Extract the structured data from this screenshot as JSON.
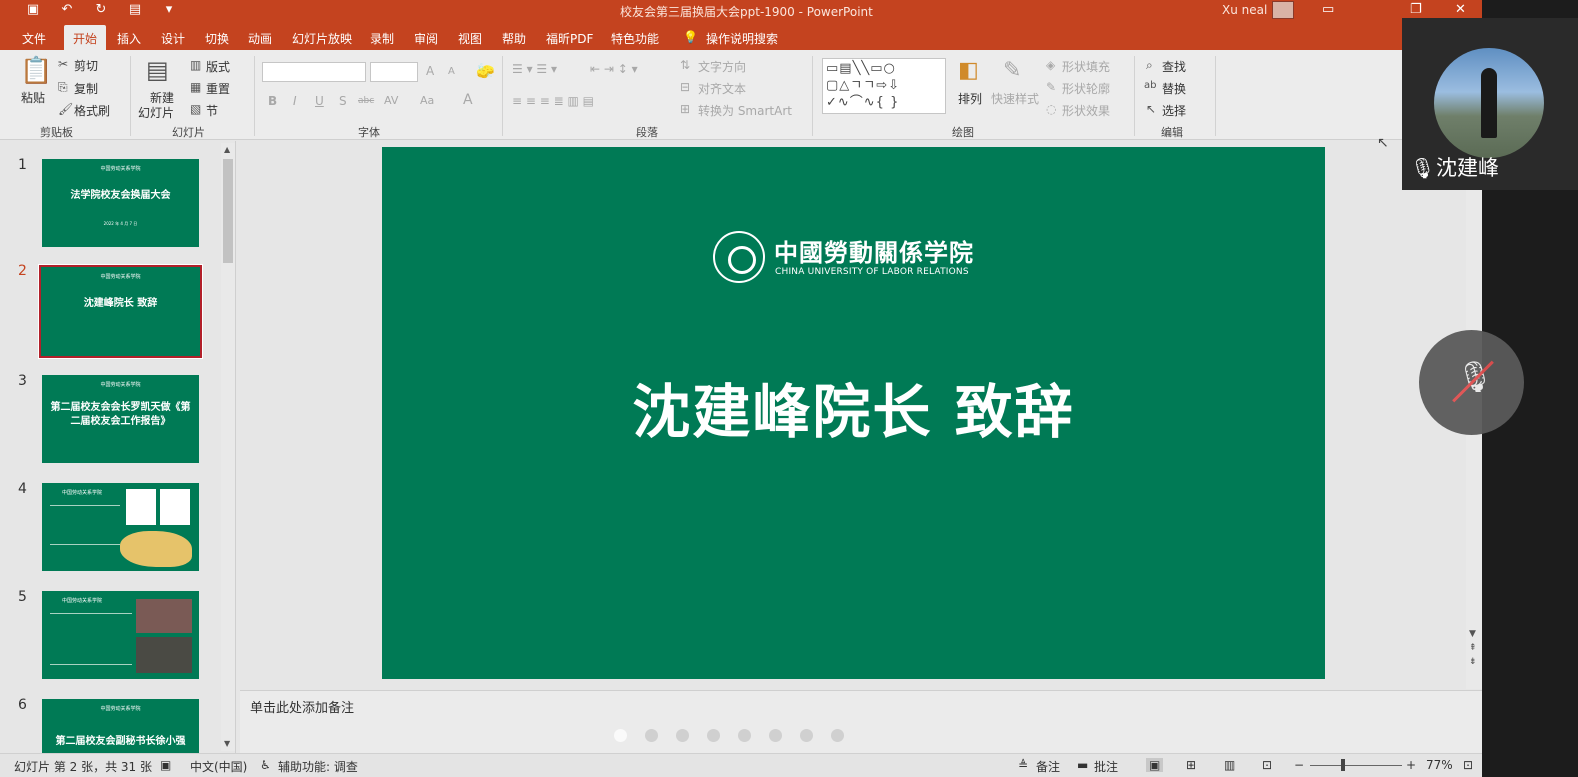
{
  "titlebar": {
    "doc_title": "校友会第三届换届大会ppt-1900  -  PowerPoint",
    "user": "Xu neal",
    "icons": [
      "save-icon",
      "undo-icon",
      "redo-icon",
      "present-icon",
      "customize-icon"
    ]
  },
  "menu": {
    "tabs": [
      "文件",
      "开始",
      "插入",
      "设计",
      "切换",
      "动画",
      "幻灯片放映",
      "录制",
      "审阅",
      "视图",
      "帮助",
      "福昕PDF",
      "特色功能"
    ],
    "active": "开始",
    "tell_me": "操作说明搜索"
  },
  "ribbon": {
    "clipboard": {
      "paste": "粘贴",
      "cut": "剪切",
      "copy": "复制",
      "format_painter": "格式刷",
      "label": "剪贴板"
    },
    "slides": {
      "new_slide_line1": "新建",
      "new_slide_line2": "幻灯片",
      "layout": "版式",
      "reset": "重置",
      "section": "节",
      "label": "幻灯片"
    },
    "font": {
      "label": "字体",
      "bold": "B",
      "italic": "I",
      "underline": "U",
      "shadow": "S",
      "strike": "abc",
      "spacing": "AV",
      "case": "Aa",
      "color": "A",
      "grow": "A",
      "shrink": "A"
    },
    "paragraph": {
      "label": "段落",
      "text_direction": "文字方向",
      "align_text": "对齐文本",
      "smartart": "转换为 SmartArt"
    },
    "drawing": {
      "label": "绘图",
      "arrange": "排列",
      "quick_styles": "快速样式",
      "shape_fill": "形状填充",
      "shape_outline": "形状轮廓",
      "shape_effects": "形状效果"
    },
    "editing": {
      "label": "编辑",
      "find": "查找",
      "replace": "替换",
      "select": "选择"
    }
  },
  "thumbnails": [
    {
      "num": "1",
      "title": "法学院校友会换届大会",
      "subtitle": "2022 年 4 月 7 日",
      "logo": "中国劳动关系学院"
    },
    {
      "num": "2",
      "title": "沈建峰院长  致辞",
      "logo": "中国劳动关系学院",
      "selected": true
    },
    {
      "num": "3",
      "title": "第二届校友会会长罗凯天做《第二届校友会工作报告》",
      "logo": "中国劳动关系学院"
    },
    {
      "num": "4",
      "title": "",
      "logo": "中国劳动关系学院"
    },
    {
      "num": "5",
      "title": "",
      "logo": "中国劳动关系学院"
    },
    {
      "num": "6",
      "title": "第二届校友会副秘书长徐小强",
      "logo": "中国劳动关系学院"
    }
  ],
  "slide": {
    "logo_cn": "中國勞動關係学院",
    "logo_en": "CHINA UNIVERSITY OF LABOR RELATIONS",
    "title": "沈建峰院长  致辞",
    "background": "#007a55"
  },
  "notes": {
    "placeholder": "单击此处添加备注"
  },
  "status": {
    "slide_info": "幻灯片 第 2 张，共 31 张",
    "language": "中文(中国)",
    "accessibility": "辅助功能: 调查",
    "notes_btn": "备注",
    "comments_btn": "批注",
    "zoom": "77%"
  },
  "video": {
    "participant": "沈建峰"
  },
  "colors": {
    "accent": "#c4431f",
    "slide_green": "#007a55",
    "selected_border": "#b2202a"
  }
}
